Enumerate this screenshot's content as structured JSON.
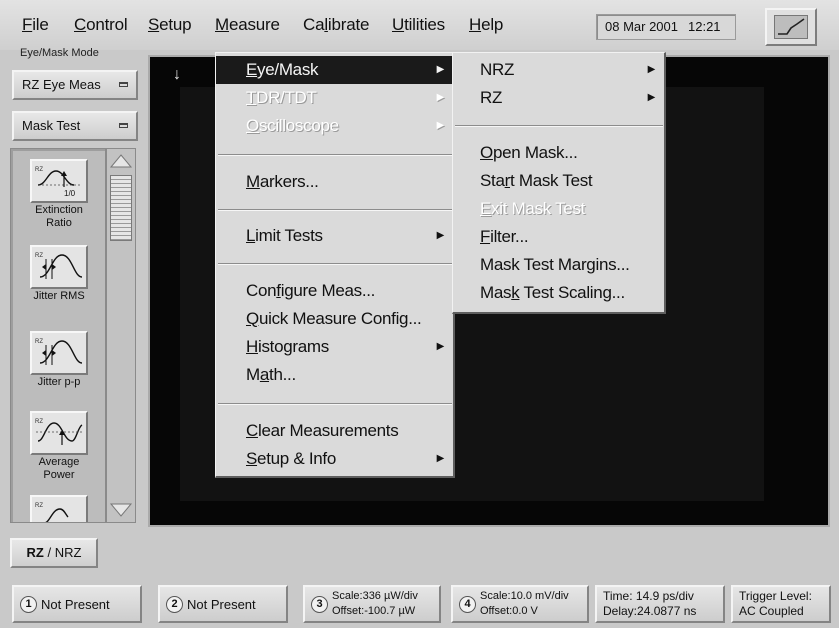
{
  "menubar": {
    "items": [
      {
        "pre": "",
        "mn": "F",
        "post": "ile"
      },
      {
        "pre": "",
        "mn": "C",
        "post": "ontrol"
      },
      {
        "pre": "",
        "mn": "S",
        "post": "etup"
      },
      {
        "pre": "",
        "mn": "M",
        "post": "easure"
      },
      {
        "pre": "Ca",
        "mn": "l",
        "post": "ibrate"
      },
      {
        "pre": "",
        "mn": "U",
        "post": "tilities"
      },
      {
        "pre": "",
        "mn": "H",
        "post": "elp"
      }
    ],
    "date": "08 Mar 2001",
    "time": "12:21"
  },
  "left_panel": {
    "mode_label": "Eye/Mask Mode",
    "eye_meas_button": "RZ Eye Meas",
    "mask_test_button": "Mask Test",
    "measurements": [
      {
        "label_1": "Extinction",
        "label_2": "Ratio"
      },
      {
        "label_1": "Jitter RMS",
        "label_2": ""
      },
      {
        "label_1": "Jitter p-p",
        "label_2": ""
      },
      {
        "label_1": "Average",
        "label_2": "Power"
      }
    ],
    "icon_tag": "RZ",
    "icon_text": "1/0",
    "rz_nrz": {
      "rz": "RZ",
      "rest": " / NRZ"
    }
  },
  "measure_menu": {
    "items": [
      {
        "pre": "",
        "u": "E",
        "post": "ye/Mask",
        "submenu": true,
        "state": "highlight"
      },
      {
        "pre": "",
        "u": "T",
        "post": "DR/TDT",
        "submenu": true,
        "state": "disabled"
      },
      {
        "pre": "",
        "u": "O",
        "post": "scilloscope",
        "submenu": true,
        "state": "disabled"
      },
      {
        "pre": "",
        "u": "M",
        "post": "arkers...",
        "submenu": false,
        "state": "normal"
      },
      {
        "pre": "",
        "u": "L",
        "post": "imit Tests",
        "submenu": true,
        "state": "normal"
      },
      {
        "pre": "Con",
        "u": "f",
        "post": "igure Meas...",
        "submenu": false,
        "state": "normal"
      },
      {
        "pre": "",
        "u": "Q",
        "post": "uick Measure Config...",
        "submenu": false,
        "state": "normal"
      },
      {
        "pre": "",
        "u": "H",
        "post": "istograms",
        "submenu": true,
        "state": "normal"
      },
      {
        "pre": "M",
        "u": "a",
        "post": "th...",
        "submenu": false,
        "state": "normal"
      },
      {
        "pre": "",
        "u": "C",
        "post": "lear Measurements",
        "submenu": false,
        "state": "normal"
      },
      {
        "pre": "",
        "u": "S",
        "post": "etup & Info",
        "submenu": true,
        "state": "normal"
      }
    ]
  },
  "eyemask_menu": {
    "items": [
      {
        "pre": "NRZ",
        "u": "",
        "post": "",
        "submenu": true,
        "state": "normal"
      },
      {
        "pre": "RZ",
        "u": "",
        "post": "",
        "submenu": true,
        "state": "normal"
      },
      {
        "pre": "",
        "u": "O",
        "post": "pen Mask...",
        "submenu": false,
        "state": "normal"
      },
      {
        "pre": "Sta",
        "u": "r",
        "post": "t Mask Test",
        "submenu": false,
        "state": "normal"
      },
      {
        "pre": "",
        "u": "E",
        "post": "xit Mask Test",
        "submenu": false,
        "state": "disabled"
      },
      {
        "pre": "",
        "u": "F",
        "post": "ilter...",
        "submenu": false,
        "state": "normal"
      },
      {
        "pre": "Mask Test Margins...",
        "u": "",
        "post": "",
        "submenu": false,
        "state": "normal"
      },
      {
        "pre": "Mas",
        "u": "k",
        "post": " Test Scaling...",
        "submenu": false,
        "state": "normal"
      }
    ]
  },
  "status_bar": {
    "ch1": {
      "num": "1",
      "text": "Not Present"
    },
    "ch2": {
      "num": "2",
      "text": "Not Present"
    },
    "ch3": {
      "num": "3",
      "line1": "Scale:336 µW/div",
      "line2": "Offset:-100.7 µW"
    },
    "ch4": {
      "num": "4",
      "line1": "Scale:10.0 mV/div",
      "line2": "Offset:0.0 V"
    },
    "timebase": {
      "line1": "Time:  14.9 ps/div",
      "line2": "Delay:24.0877 ns"
    },
    "trigger": {
      "line1": "Trigger Level:",
      "line2": "AC Coupled"
    }
  },
  "display": {
    "trigger_marker": "↓"
  },
  "glyphs": {
    "submenu_arrow": "▶"
  }
}
